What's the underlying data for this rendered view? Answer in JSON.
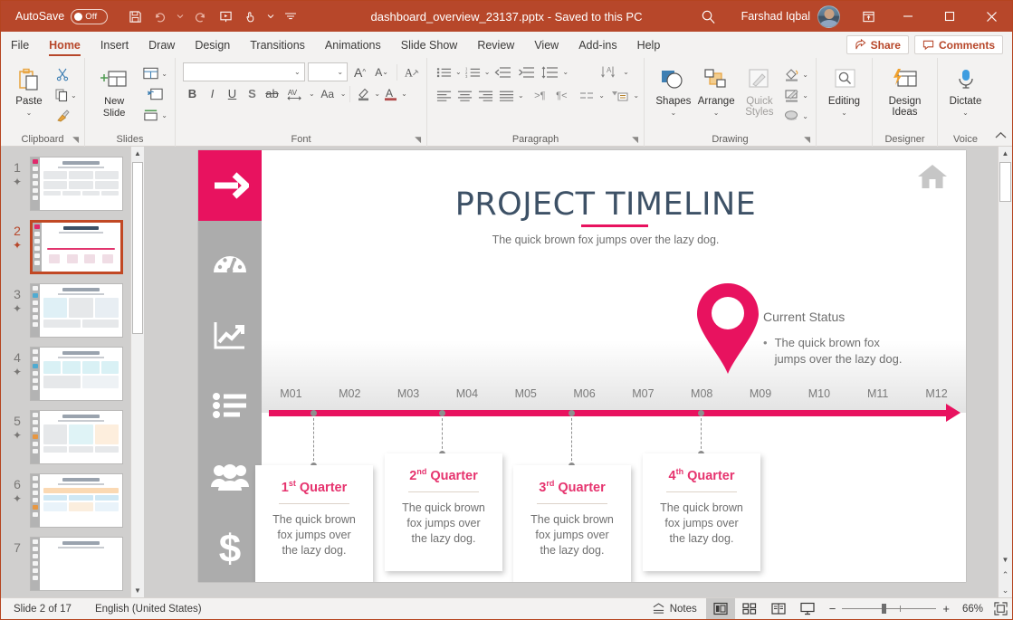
{
  "titlebar": {
    "autosave_label": "AutoSave",
    "autosave_state": "Off",
    "filename": "dashboard_overview_23137.pptx",
    "save_state": "-  Saved to this PC",
    "user_name": "Farshad Iqbal",
    "icons": [
      "save-icon",
      "undo-icon",
      "redo-icon",
      "start-presentation-icon",
      "touch-mode-icon",
      "customize-qat-icon"
    ],
    "window_buttons": [
      "minimize",
      "maximize",
      "close"
    ]
  },
  "ribbon": {
    "tabs": [
      {
        "label": "File",
        "active": false
      },
      {
        "label": "Home",
        "active": true
      },
      {
        "label": "Insert",
        "active": false
      },
      {
        "label": "Draw",
        "active": false
      },
      {
        "label": "Design",
        "active": false
      },
      {
        "label": "Transitions",
        "active": false
      },
      {
        "label": "Animations",
        "active": false
      },
      {
        "label": "Slide Show",
        "active": false
      },
      {
        "label": "Review",
        "active": false
      },
      {
        "label": "View",
        "active": false
      },
      {
        "label": "Add-ins",
        "active": false
      },
      {
        "label": "Help",
        "active": false
      }
    ],
    "share_label": "Share",
    "comments_label": "Comments",
    "groups": {
      "clipboard": {
        "label": "Clipboard",
        "paste": "Paste"
      },
      "slides": {
        "label": "Slides",
        "new_slide": "New Slide"
      },
      "font": {
        "label": "Font",
        "font_name_value": "",
        "font_size_value": ""
      },
      "paragraph": {
        "label": "Paragraph"
      },
      "drawing": {
        "label": "Drawing",
        "shapes": "Shapes",
        "arrange": "Arrange",
        "quick_styles_line1": "Quick",
        "quick_styles_line2": "Styles"
      },
      "editing": {
        "label": "",
        "editing": "Editing"
      },
      "designer": {
        "label": "Designer",
        "design_ideas_line1": "Design",
        "design_ideas_line2": "Ideas"
      },
      "voice": {
        "label": "Voice",
        "dictate": "Dictate"
      }
    }
  },
  "thumbnails": [
    {
      "number": "1",
      "title": "DASHBOARD OVERVIEW",
      "active": false
    },
    {
      "number": "2",
      "title": "PROJECT TIMELINE",
      "active": true
    },
    {
      "number": "3",
      "title": "Performance Analysis",
      "active": false
    },
    {
      "number": "4",
      "title": "Monthly Revisions",
      "active": false
    },
    {
      "number": "5",
      "title": "Skills Analysis",
      "active": false
    },
    {
      "number": "6",
      "title": "Team Organization",
      "active": false
    },
    {
      "number": "7",
      "title": "Sales Forecast",
      "active": false
    }
  ],
  "slide": {
    "title": "PROJECT TIMELINE",
    "subtitle": "The quick brown fox jumps over the lazy dog.",
    "home_icon": "home-icon",
    "sidebar_icons": [
      "arrow-right-icon",
      "gauge-icon",
      "chart-line-icon",
      "list-icon",
      "people-icon",
      "dollar-icon"
    ],
    "status": {
      "heading": "Current Status",
      "bullet": "•",
      "item": "The quick brown fox jumps over the lazy dog."
    },
    "timeline": {
      "months": [
        "M01",
        "M02",
        "M03",
        "M04",
        "M05",
        "M06",
        "M07",
        "M08",
        "M09",
        "M10",
        "M11",
        "M12"
      ],
      "marker_month": "M09"
    },
    "cards": [
      {
        "ordinal": "1",
        "suffix": "st",
        "label": "Quarter",
        "body": "The quick brown fox jumps over the lazy dog."
      },
      {
        "ordinal": "2",
        "suffix": "nd",
        "label": "Quarter",
        "body": "The quick brown fox jumps over the lazy dog."
      },
      {
        "ordinal": "3",
        "suffix": "rd",
        "label": "Quarter",
        "body": "The quick brown fox jumps over the lazy dog."
      },
      {
        "ordinal": "4",
        "suffix": "th",
        "label": "Quarter",
        "body": "The quick brown fox jumps over the lazy dog."
      }
    ],
    "colors": {
      "accent_pink": "#e8125f",
      "title_blue": "#3d5166",
      "sidebar_gray": "#acacac",
      "card_title": "#e6336e"
    }
  },
  "statusbar": {
    "slide_count": "Slide 2 of 17",
    "language": "English (United States)",
    "notes_label": "Notes",
    "views": [
      "normal-view",
      "slide-sorter-view",
      "reading-view",
      "slide-show-view"
    ],
    "zoom_out": "−",
    "zoom_in": "+",
    "zoom_level": "66%",
    "fit_label": "fit-slide-to-window"
  }
}
